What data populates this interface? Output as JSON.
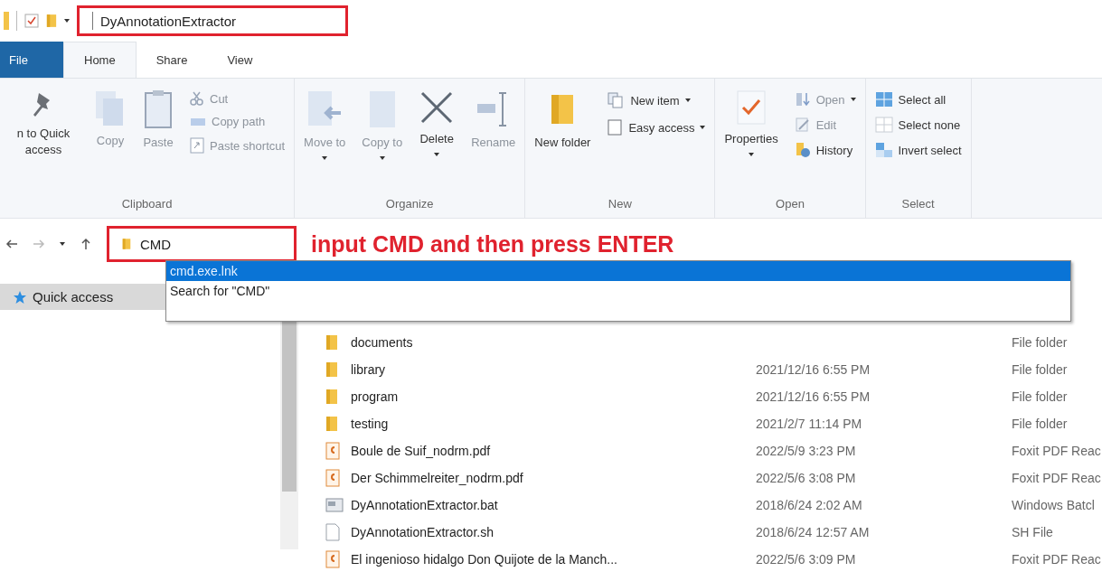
{
  "window": {
    "title": "DyAnnotationExtractor"
  },
  "tabs": [
    {
      "label": "File",
      "selected": false,
      "kind": "file"
    },
    {
      "label": "Home",
      "selected": true,
      "kind": "tab"
    },
    {
      "label": "Share",
      "selected": false,
      "kind": "tab"
    },
    {
      "label": "View",
      "selected": false,
      "kind": "tab"
    }
  ],
  "ribbon": {
    "groups": [
      {
        "label": "Clipboard",
        "items": [
          {
            "kind": "large",
            "label": "n to Quick access",
            "disabled": false
          },
          {
            "kind": "large",
            "label": "Copy",
            "disabled": true
          },
          {
            "kind": "large",
            "label": "Paste",
            "disabled": true
          },
          {
            "kind": "small",
            "label": "Cut",
            "disabled": true
          },
          {
            "kind": "small",
            "label": "Copy path",
            "disabled": true
          },
          {
            "kind": "small",
            "label": "Paste shortcut",
            "disabled": true
          }
        ]
      },
      {
        "label": "Organize",
        "items": [
          {
            "kind": "large",
            "label": "Move to",
            "disabled": true,
            "dropdown": true
          },
          {
            "kind": "large",
            "label": "Copy to",
            "disabled": true,
            "dropdown": true
          },
          {
            "kind": "large",
            "label": "Delete",
            "disabled": false,
            "dropdown": true
          },
          {
            "kind": "large",
            "label": "Rename",
            "disabled": true
          }
        ]
      },
      {
        "label": "New",
        "items": [
          {
            "kind": "large",
            "label": "New folder",
            "disabled": false
          },
          {
            "kind": "small",
            "label": "New item",
            "disabled": false,
            "dropdown": true
          },
          {
            "kind": "small",
            "label": "Easy access",
            "disabled": false,
            "dropdown": true
          }
        ]
      },
      {
        "label": "Open",
        "items": [
          {
            "kind": "large",
            "label": "Properties",
            "disabled": false,
            "dropdown": true
          },
          {
            "kind": "small",
            "label": "Open",
            "disabled": true,
            "dropdown": true
          },
          {
            "kind": "small",
            "label": "Edit",
            "disabled": true
          },
          {
            "kind": "small",
            "label": "History",
            "disabled": false
          }
        ]
      },
      {
        "label": "Select",
        "items": [
          {
            "kind": "small",
            "label": "Select all",
            "disabled": false
          },
          {
            "kind": "small",
            "label": "Select none",
            "disabled": false
          },
          {
            "kind": "small",
            "label": "Invert select",
            "disabled": false
          }
        ]
      }
    ]
  },
  "address_bar": {
    "value": "CMD",
    "annotation": "input CMD and then press ENTER",
    "suggestions": [
      {
        "label": "cmd.exe.lnk",
        "selected": true
      },
      {
        "label": "Search for \"CMD\"",
        "selected": false
      }
    ]
  },
  "navigation_pane": {
    "items": [
      {
        "label": "Quick access",
        "selected": true
      }
    ]
  },
  "files": [
    {
      "kind": "folder",
      "name": "documents",
      "type": "File folder"
    },
    {
      "kind": "folder",
      "name": "library",
      "date": "2021/12/16 6:55 PM",
      "type": "File folder"
    },
    {
      "kind": "folder",
      "name": "program",
      "date": "2021/12/16 6:55 PM",
      "type": "File folder"
    },
    {
      "kind": "folder",
      "name": "testing",
      "date": "2021/2/7 11:14 PM",
      "type": "File folder"
    },
    {
      "kind": "pdf",
      "name": "Boule de Suif_nodrm.pdf",
      "date": "2022/5/9 3:23 PM",
      "type": "Foxit PDF Reac"
    },
    {
      "kind": "pdf",
      "name": "Der Schimmelreiter_nodrm.pdf",
      "date": "2022/5/6 3:08 PM",
      "type": "Foxit PDF Reac"
    },
    {
      "kind": "bat",
      "name": "DyAnnotationExtractor.bat",
      "date": "2018/6/24 2:02 AM",
      "type": "Windows Batcl"
    },
    {
      "kind": "sh",
      "name": "DyAnnotationExtractor.sh",
      "date": "2018/6/24 12:57 AM",
      "type": "SH File"
    },
    {
      "kind": "pdf",
      "name": "El ingenioso hidalgo Don Quijote de la Manch...",
      "date": "2022/5/6 3:09 PM",
      "type": "Foxit PDF Reac"
    }
  ]
}
